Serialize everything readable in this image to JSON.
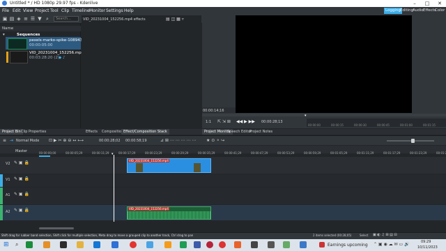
{
  "window": {
    "title": "Untitled * / HD 1080p 29.97 fps - Kdenlive"
  },
  "menu": [
    "File",
    "Edit",
    "View",
    "Project",
    "Tool",
    "Clip",
    "Timeline",
    "Monitor",
    "Settings",
    "Help"
  ],
  "workspaces": [
    "Logging",
    "Editing",
    "Audio",
    "Effects",
    "Color"
  ],
  "active_workspace": "Logging",
  "bin": {
    "search_placeholder": "Search...",
    "column_name": "Name",
    "folder": "Sequences",
    "items": [
      {
        "name": "pexels-marko-spike-1089438",
        "duration": "00:00:05:00"
      },
      {
        "name": "VID_20231004_152256.mp4",
        "duration": "00:03:28:20 (2)"
      }
    ]
  },
  "effects_header": "VID_20231004_152256.mp4 effects",
  "monitor": {
    "timecode": "00:00:14;16",
    "zoom": "1:1",
    "position_tc": "00:00:28;13",
    "ruler_ticks": [
      "00:00:00",
      "00:00:15",
      "00:00:30",
      "00:00:45",
      "00:01:00",
      "00:01:15",
      "00:01:30"
    ]
  },
  "tabs_left": [
    "Project Bin",
    "Clip Properties"
  ],
  "tabs_mid": [
    "Effects",
    "Compositions",
    "Effect/Composition Stack"
  ],
  "tabs_right": [
    "Project Monitor",
    "Speech Editor",
    "Project Notes"
  ],
  "timeline": {
    "mode": "Normal Mode",
    "timecode_position": "00:00:28;02",
    "timecode_total": "00:00:58;19",
    "master_label": "Master",
    "ruler": [
      "00:00:00;00",
      "00:00:05;29",
      "00:00:11;29",
      "00:00:17;29",
      "00:00:23;29",
      "00:00:29;29",
      "00:00:35;29",
      "00:00:41;29",
      "00:00:47;29",
      "00:00:53;29",
      "00:00:59;29",
      "00:01:05;29",
      "00:01:11;29",
      "00:01:17;29",
      "00:01:23;29",
      "00:01:29;29"
    ],
    "tracks": [
      {
        "name": "V2"
      },
      {
        "name": "V1"
      },
      {
        "name": "A1"
      },
      {
        "name": "A2"
      }
    ],
    "video_clip_label": "VID_20231004_152256.mp4",
    "audio_clip_label": "VID_20231004_152256.mp4"
  },
  "status": {
    "hint": "Shift drag for rubber band selection, Shift click for multiple selection, Meta drag to move a grouped clip to another track, Ctrl drag to pan",
    "selection": "2 items selected (00:28;05)",
    "select_label": "Select"
  },
  "taskbar": {
    "news": "Earnings upcoming",
    "time": "09:29",
    "date": "10/11/2023"
  },
  "colors": {
    "accent": "#3daee9",
    "video_clip": "#2a8fe0",
    "audio_clip": "#1d5e36",
    "playhead": "#ffffff"
  }
}
